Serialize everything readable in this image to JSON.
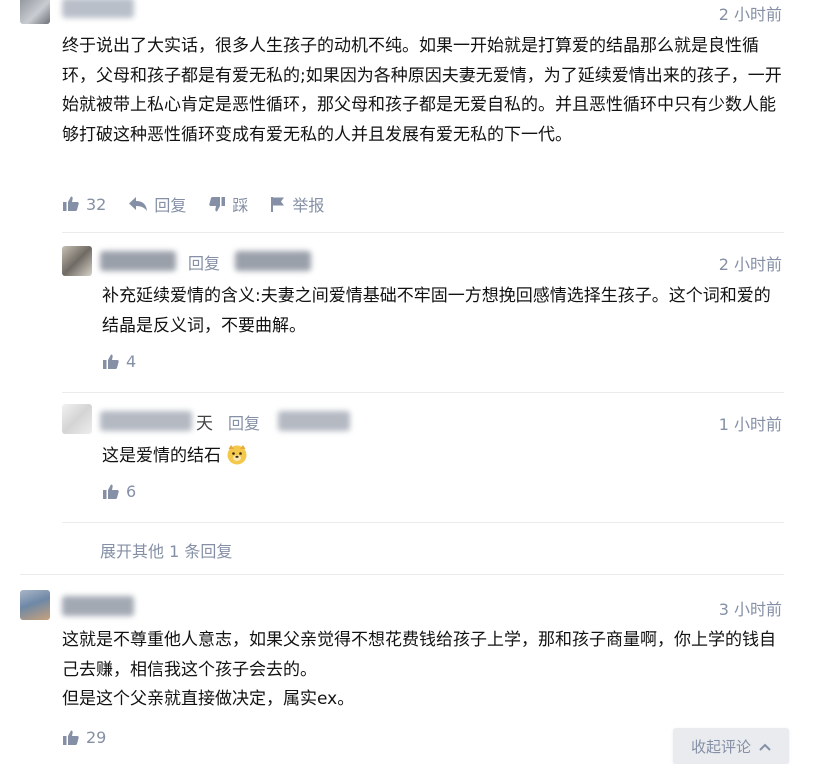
{
  "comments": [
    {
      "time": "2 小时前",
      "text": "终于说出了大实话，很多人生孩子的动机不纯。如果一开始就是打算爱的结晶那么就是良性循环，父母和孩子都是有爱无私的;如果因为各种原因夫妻无爱情，为了延续爱情出来的孩子，一开始就被带上私心肯定是恶性循环，那父母和孩子都是无爱自私的。并且恶性循环中只有少数人能够打破这种恶性循环变成有爱无私的人并且发展有爱无私的下一代。",
      "likes": "32",
      "reply_label": "回复",
      "dislike_label": "踩",
      "report_label": "举报",
      "replies": [
        {
          "time": "2 小时前",
          "reply_word": "回复",
          "text": "补充延续爱情的含义:夫妻之间爱情基础不牢固一方想挽回感情选择生孩子。这个词和爱的结晶是反义词，不要曲解。",
          "likes": "4"
        },
        {
          "time": "1 小时前",
          "name_visible_char": "天",
          "reply_word": "回复",
          "text": "这是爱情的结石",
          "likes": "6"
        }
      ],
      "expand_label": "展开其他 1 条回复"
    },
    {
      "time": "3 小时前",
      "text_line1": "这就是不尊重他人意志，如果父亲觉得不想花费钱给孩子上学，那和孩子商量啊，你上学的钱自己去赚，相信我这个孩子会去的。",
      "text_line2": "但是这个父亲就直接做决定，属实ex。",
      "likes": "29"
    }
  ],
  "collapse_label": "收起评论",
  "icons": {
    "like": "thumbs-up-icon",
    "reply": "reply-arrow-icon",
    "dislike": "thumbs-down-icon",
    "report": "flag-icon",
    "collapse": "chevron-up-icon",
    "emoji": "dog-face-emoji"
  },
  "colors": {
    "muted": "#8590a6",
    "text": "#121212",
    "divider": "#ebebeb",
    "button_bg": "#e9ebee"
  }
}
